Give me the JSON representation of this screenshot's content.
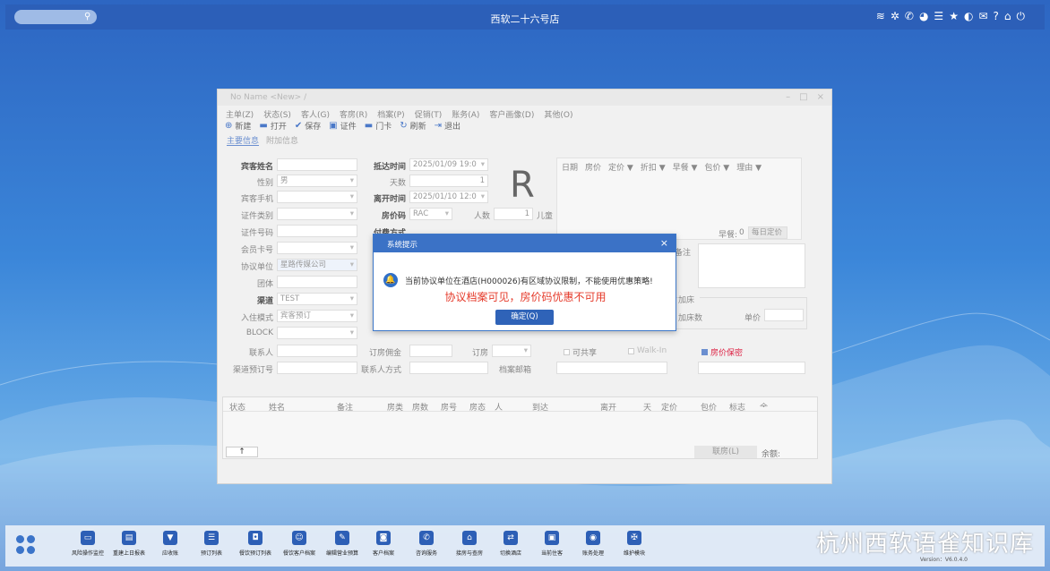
{
  "os": {
    "title": "西软二十六号店",
    "tray_icons": [
      "wifi-icon",
      "tools-icon",
      "phone-icon",
      "palette-icon",
      "list-icon",
      "star-icon",
      "moon-icon",
      "mail-icon",
      "help-icon",
      "home-icon",
      "power-icon"
    ]
  },
  "window": {
    "title": "No Name <New> /",
    "menu": [
      "主单(Z)",
      "状态(S)",
      "客人(G)",
      "客房(R)",
      "档案(P)",
      "促销(T)",
      "账务(A)",
      "客户画像(D)",
      "其他(O)"
    ],
    "toolbar": [
      {
        "label": "新建",
        "icon": "plus-circle-icon"
      },
      {
        "label": "打开",
        "icon": "folder-icon"
      },
      {
        "label": "保存",
        "icon": "check-circle-icon"
      },
      {
        "label": "证件",
        "icon": "id-card-icon"
      },
      {
        "label": "门卡",
        "icon": "card-icon"
      },
      {
        "label": "刷新",
        "icon": "refresh-icon"
      },
      {
        "label": "退出",
        "icon": "exit-icon"
      }
    ],
    "tabs": [
      "主要信息",
      "附加信息"
    ]
  },
  "form": {
    "guest_name_label": "宾客姓名",
    "gender_label": "性别",
    "gender_value": "男",
    "phone_label": "宾客手机",
    "idtype_label": "证件类别",
    "idno_label": "证件号码",
    "member_label": "会员卡号",
    "agreement_label": "协议单位",
    "agreement_value": "星路传媒公司",
    "group_label": "团体",
    "channel_label": "渠道",
    "channel_value": "TEST",
    "checkin_mode_label": "入住模式",
    "checkin_mode_value": "宾客预订",
    "block_label": "BLOCK",
    "contact_label": "联系人",
    "channel_order_label": "渠道预订号",
    "arrival_label": "抵达时间",
    "arrival_value": "2025/01/09 19:0",
    "days_label": "天数",
    "days_value": "1",
    "depart_label": "离开时间",
    "depart_value": "2025/01/10 12:0",
    "ratecode_label": "房价码",
    "ratecode_value": "RAC",
    "adults_label": "人数",
    "adults_value": "1",
    "children_label": "儿童",
    "pay_label": "付费方式",
    "commission_label": "订房佣金",
    "booking_label": "订房",
    "contact_method_label": "联系人方式",
    "profile_email_label": "档案邮箱",
    "share_label": "可共享",
    "walkin_label": "Walk-In",
    "rate_secret_label": "房价保密",
    "big_letter": "R",
    "rate_headers": [
      "日期",
      "房价",
      "定价 ▼",
      "折扣 ▼",
      "早餐 ▼",
      "包价 ▼",
      "理由 ▼"
    ],
    "breakfast_label": "早餐:",
    "breakfast_value": "0",
    "daily_rate_btn": "每日定价",
    "remark_label": "备注",
    "extra_bed_title": "加床",
    "extra_bed_count_label": "加床数",
    "unit_price_label": "单价"
  },
  "grid": {
    "headers": [
      "状态",
      "姓名",
      "备注",
      "房类",
      "房数",
      "房号",
      "房态",
      "人",
      "到达",
      "离开",
      "天",
      "定价",
      "包价",
      "标志",
      "余额"
    ],
    "up_arrow": "↑",
    "link_btn": "联房(L)",
    "balance_label": "余额:"
  },
  "dialog": {
    "title": "系统提示",
    "close": "×",
    "message": "当前协议单位在酒店(H000026)有区域协议限制，不能使用优惠策略!",
    "red_note": "协议档案可见，房价码优惠不可用",
    "ok": "确定(Q)"
  },
  "taskbar": {
    "apps": [
      {
        "label": "风险操作监控",
        "icon": "monitor-icon"
      },
      {
        "label": "重建上日报表",
        "icon": "report-icon"
      },
      {
        "label": "应收账",
        "icon": "download-icon"
      },
      {
        "label": "预订列表",
        "icon": "list-icon"
      },
      {
        "label": "餐饮预订列表",
        "icon": "dining-icon"
      },
      {
        "label": "餐饮客户档案",
        "icon": "user-icon"
      },
      {
        "label": "编辑营业预算",
        "icon": "edit-icon"
      },
      {
        "label": "客户档案",
        "icon": "profile-icon"
      },
      {
        "label": "咨询服务",
        "icon": "phone-icon"
      },
      {
        "label": "接房与查房",
        "icon": "house-icon"
      },
      {
        "label": "切换酒店",
        "icon": "switch-icon"
      },
      {
        "label": "当前住客",
        "icon": "guest-icon"
      },
      {
        "label": "账务处理",
        "icon": "chat-icon"
      },
      {
        "label": "维护模块",
        "icon": "wrench-icon"
      }
    ],
    "watermark": "杭州西软语雀知识库",
    "version": "Version：V6.0.4.0"
  },
  "colors": {
    "accent": "#2f63b8",
    "alert_red": "#e53a2a",
    "title_bar": "#3b72c6"
  }
}
